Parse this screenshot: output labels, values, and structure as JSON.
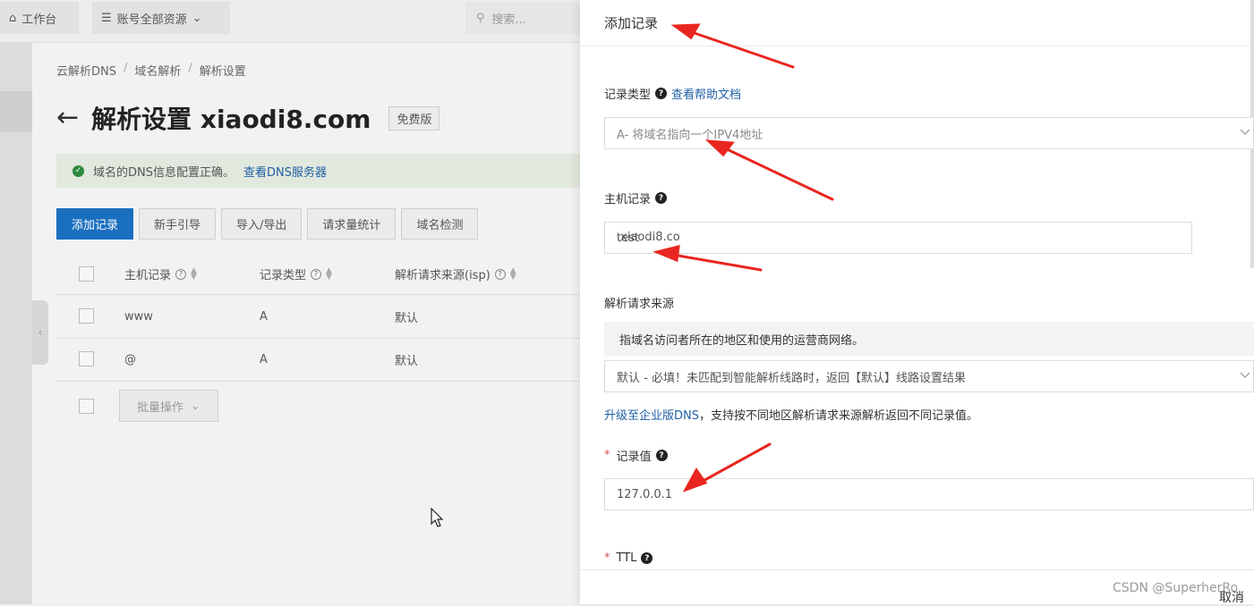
{
  "topbar": {
    "workbench": "工作台",
    "resources": "账号全部资源",
    "search_placeholder": "搜索..."
  },
  "breadcrumb": [
    "云解析DNS",
    "域名解析",
    "解析设置"
  ],
  "page": {
    "title": "解析设置 xiaodi8.com",
    "badge": "免费版"
  },
  "alert": {
    "text": "域名的DNS信息配置正确。",
    "link": "查看DNS服务器"
  },
  "actions": [
    "添加记录",
    "新手引导",
    "导入/导出",
    "请求量统计",
    "域名检测"
  ],
  "table": {
    "headers": [
      "主机记录",
      "记录类型",
      "解析请求来源(isp)"
    ],
    "rows": [
      [
        "www",
        "A",
        "默认"
      ],
      [
        "@",
        "A",
        "默认"
      ]
    ],
    "bulk_label": "批量操作"
  },
  "drawer": {
    "title": "添加记录",
    "record_type_label": "记录类型",
    "help_link": "查看帮助文档",
    "record_type_value": "A- 将域名指向一个IPV4地址",
    "host_label": "主机记录",
    "host_value": "test",
    "host_suffix": ".xiaodi8.co",
    "source_label": "解析请求来源",
    "source_info": "指域名访问者所在的地区和使用的运营商网络。",
    "source_value": "默认 - 必填！未匹配到智能解析线路时，返回【默认】线路设置结果",
    "upgrade_link": "升级至企业版DNS",
    "upgrade_text": "，支持按不同地区解析请求来源解析返回不同记录值。",
    "value_label": "记录值",
    "value_value": "127.0.0.1",
    "ttl_label": "TTL",
    "cancel": "取消"
  },
  "watermark": "CSDN @SuperherRo",
  "colors": {
    "primary": "#1b6fbf",
    "link": "#1f5fa6",
    "arrow": "#e8261f",
    "required": "#d9534f"
  }
}
